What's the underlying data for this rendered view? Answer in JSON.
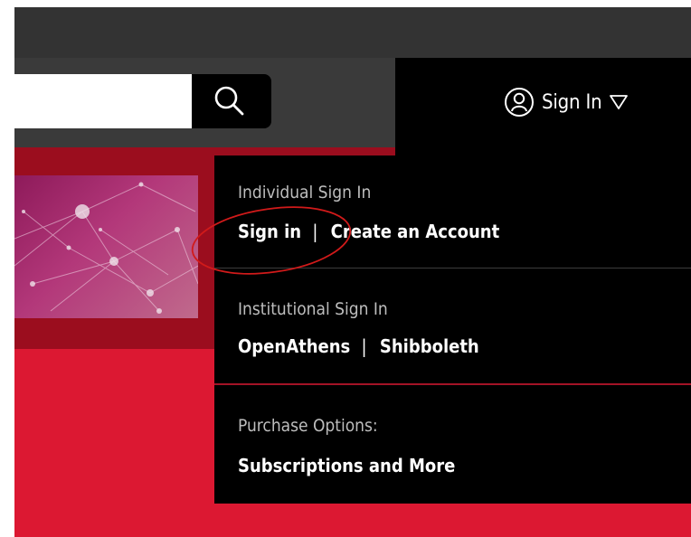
{
  "header": {
    "search": {
      "value": "",
      "placeholder": ""
    },
    "search_button_icon": "search-icon",
    "signin_trigger": {
      "label": "Sign In",
      "user_icon": "user-circle-icon",
      "caret_icon": "triangle-down-icon"
    }
  },
  "dropdown": {
    "individual": {
      "title": "Individual Sign In",
      "sign_in_label": "Sign in",
      "separator": "|",
      "create_account_label": "Create an Account"
    },
    "institutional": {
      "title": "Institutional Sign In",
      "openathens_label": "OpenAthens",
      "separator": "|",
      "shibboleth_label": "Shibboleth"
    },
    "purchase": {
      "title": "Purchase Options:",
      "subscriptions_label": "Subscriptions and More"
    }
  },
  "colors": {
    "topbar": "#333333",
    "search_strip": "#3a3a3a",
    "account_bar": "#000000",
    "hero_dark_red": "#9b0d1e",
    "hero_red": "#dc1832",
    "divider_red": "#a31326",
    "annotation": "#d11a1a"
  }
}
